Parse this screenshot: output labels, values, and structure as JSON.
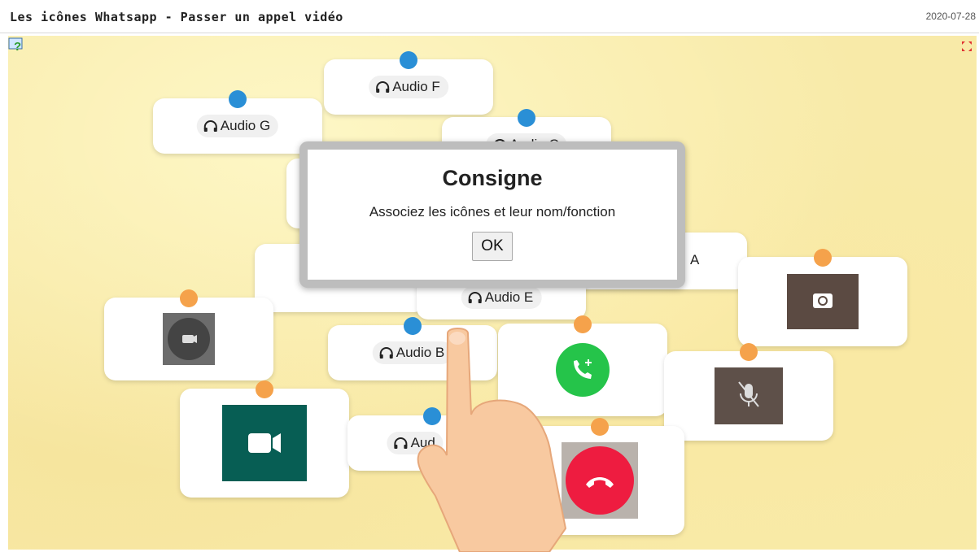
{
  "header": {
    "title": "Les icônes Whatsapp - Passer un appel vidéo",
    "date": "2020-07-28"
  },
  "audio_cards": [
    {
      "label": "Audio F"
    },
    {
      "label": "Audio G"
    },
    {
      "label": "Audio C"
    },
    {
      "label": "A"
    },
    {
      "label": "Audio E"
    },
    {
      "label": "Audio B"
    },
    {
      "label": "Aud"
    }
  ],
  "icon_cards": [
    {
      "icon": "switch-camera-icon"
    },
    {
      "icon": "camera-off-icon"
    },
    {
      "icon": "add-participant-icon"
    },
    {
      "icon": "mute-microphone-icon"
    },
    {
      "icon": "video-camera-icon"
    },
    {
      "icon": "end-call-icon"
    }
  ],
  "modal": {
    "title": "Consigne",
    "text": "Associez les icônes et leur nom/fonction",
    "ok_label": "OK"
  },
  "colors": {
    "board": "#f8eaa8",
    "pin_blue": "#2a8fd6",
    "pin_orange": "#f5a24b",
    "whatsapp_green": "#075e54",
    "call_green": "#25c44a",
    "end_red": "#ee1c40"
  }
}
